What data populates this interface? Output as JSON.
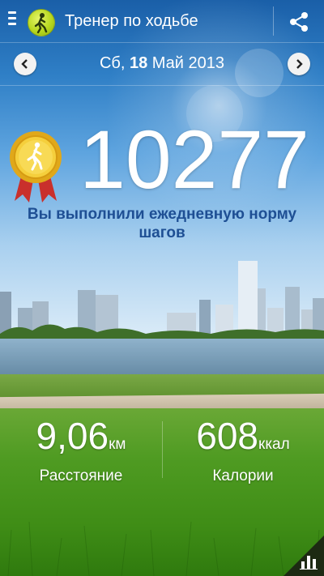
{
  "header": {
    "app_title": "Тренер по ходьбе",
    "icons": {
      "menu": "menu-icon",
      "logo": "walking-figure-icon",
      "share": "share-icon"
    }
  },
  "date_bar": {
    "weekday": "Сб,",
    "day": "18",
    "month_year": "Май 2013",
    "prev_icon": "chevron-left-icon",
    "next_icon": "chevron-right-icon"
  },
  "main": {
    "steps": "10277",
    "goal_message": "Вы выполнили ежедневную норму шагов",
    "medal_icon": "gold-medal-icon"
  },
  "stats": {
    "distance": {
      "value": "9,06",
      "unit": "км",
      "label": "Расстояние"
    },
    "calories": {
      "value": "608",
      "unit": "ккал",
      "label": "Калории"
    }
  },
  "footer": {
    "chart_icon": "bar-chart-icon"
  },
  "colors": {
    "goal_text": "#1e4f94",
    "sky": "#2f7fc6",
    "grass": "#4f9b22"
  }
}
